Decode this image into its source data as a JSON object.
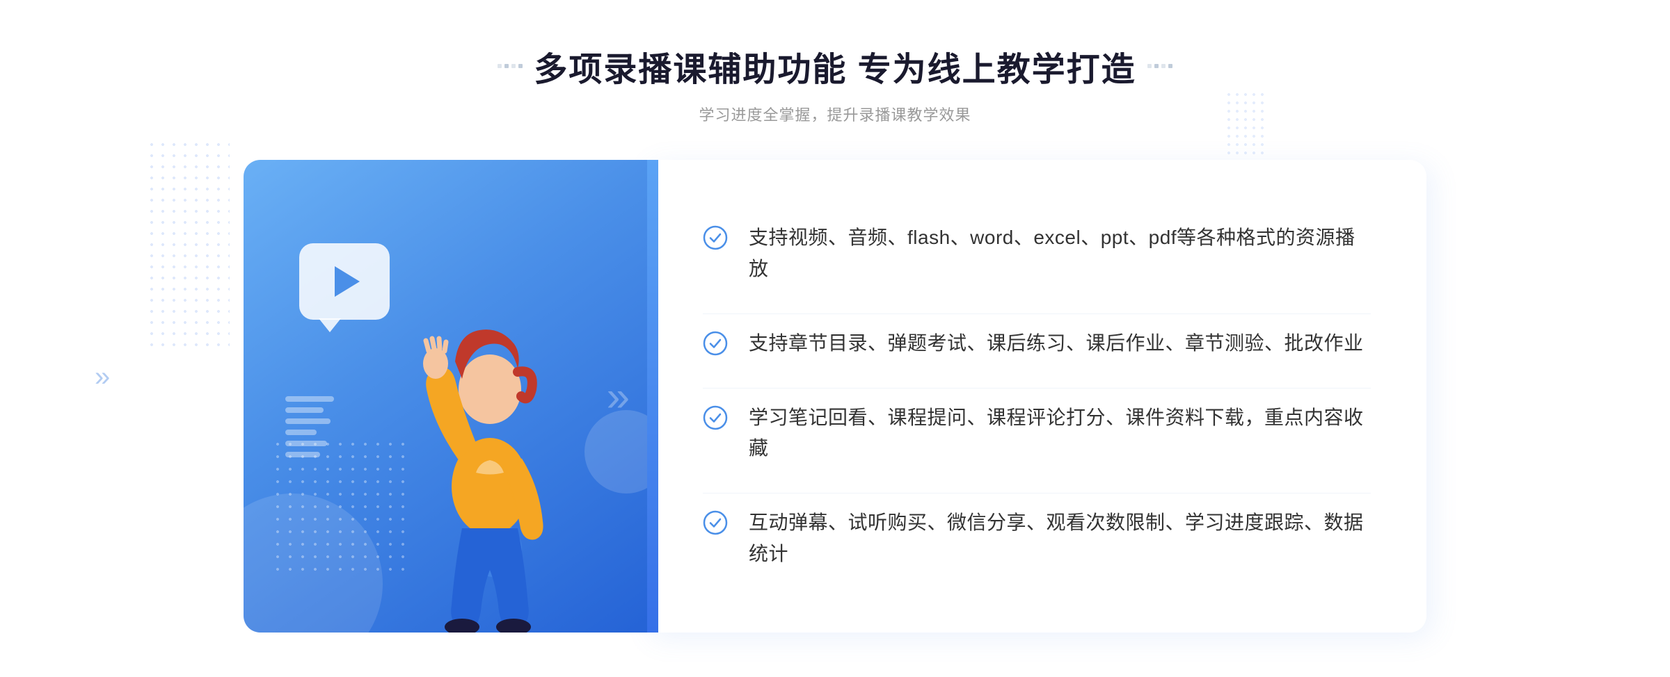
{
  "header": {
    "title": "多项录播课辅助功能 专为线上教学打造",
    "subtitle": "学习进度全掌握，提升录播课教学效果",
    "decoration_dots": "····"
  },
  "features": [
    {
      "id": 1,
      "text": "支持视频、音频、flash、word、excel、ppt、pdf等各种格式的资源播放"
    },
    {
      "id": 2,
      "text": "支持章节目录、弹题考试、课后练习、课后作业、章节测验、批改作业"
    },
    {
      "id": 3,
      "text": "学习笔记回看、课程提问、课程评论打分、课件资料下载，重点内容收藏"
    },
    {
      "id": 4,
      "text": "互动弹幕、试听购买、微信分享、观看次数限制、学习进度跟踪、数据统计"
    }
  ],
  "colors": {
    "primary_blue": "#4a8fe8",
    "light_blue": "#6ab0f5",
    "dark_blue": "#2563d6",
    "check_color": "#4a8fe8",
    "text_dark": "#333333",
    "text_light": "#999999"
  }
}
